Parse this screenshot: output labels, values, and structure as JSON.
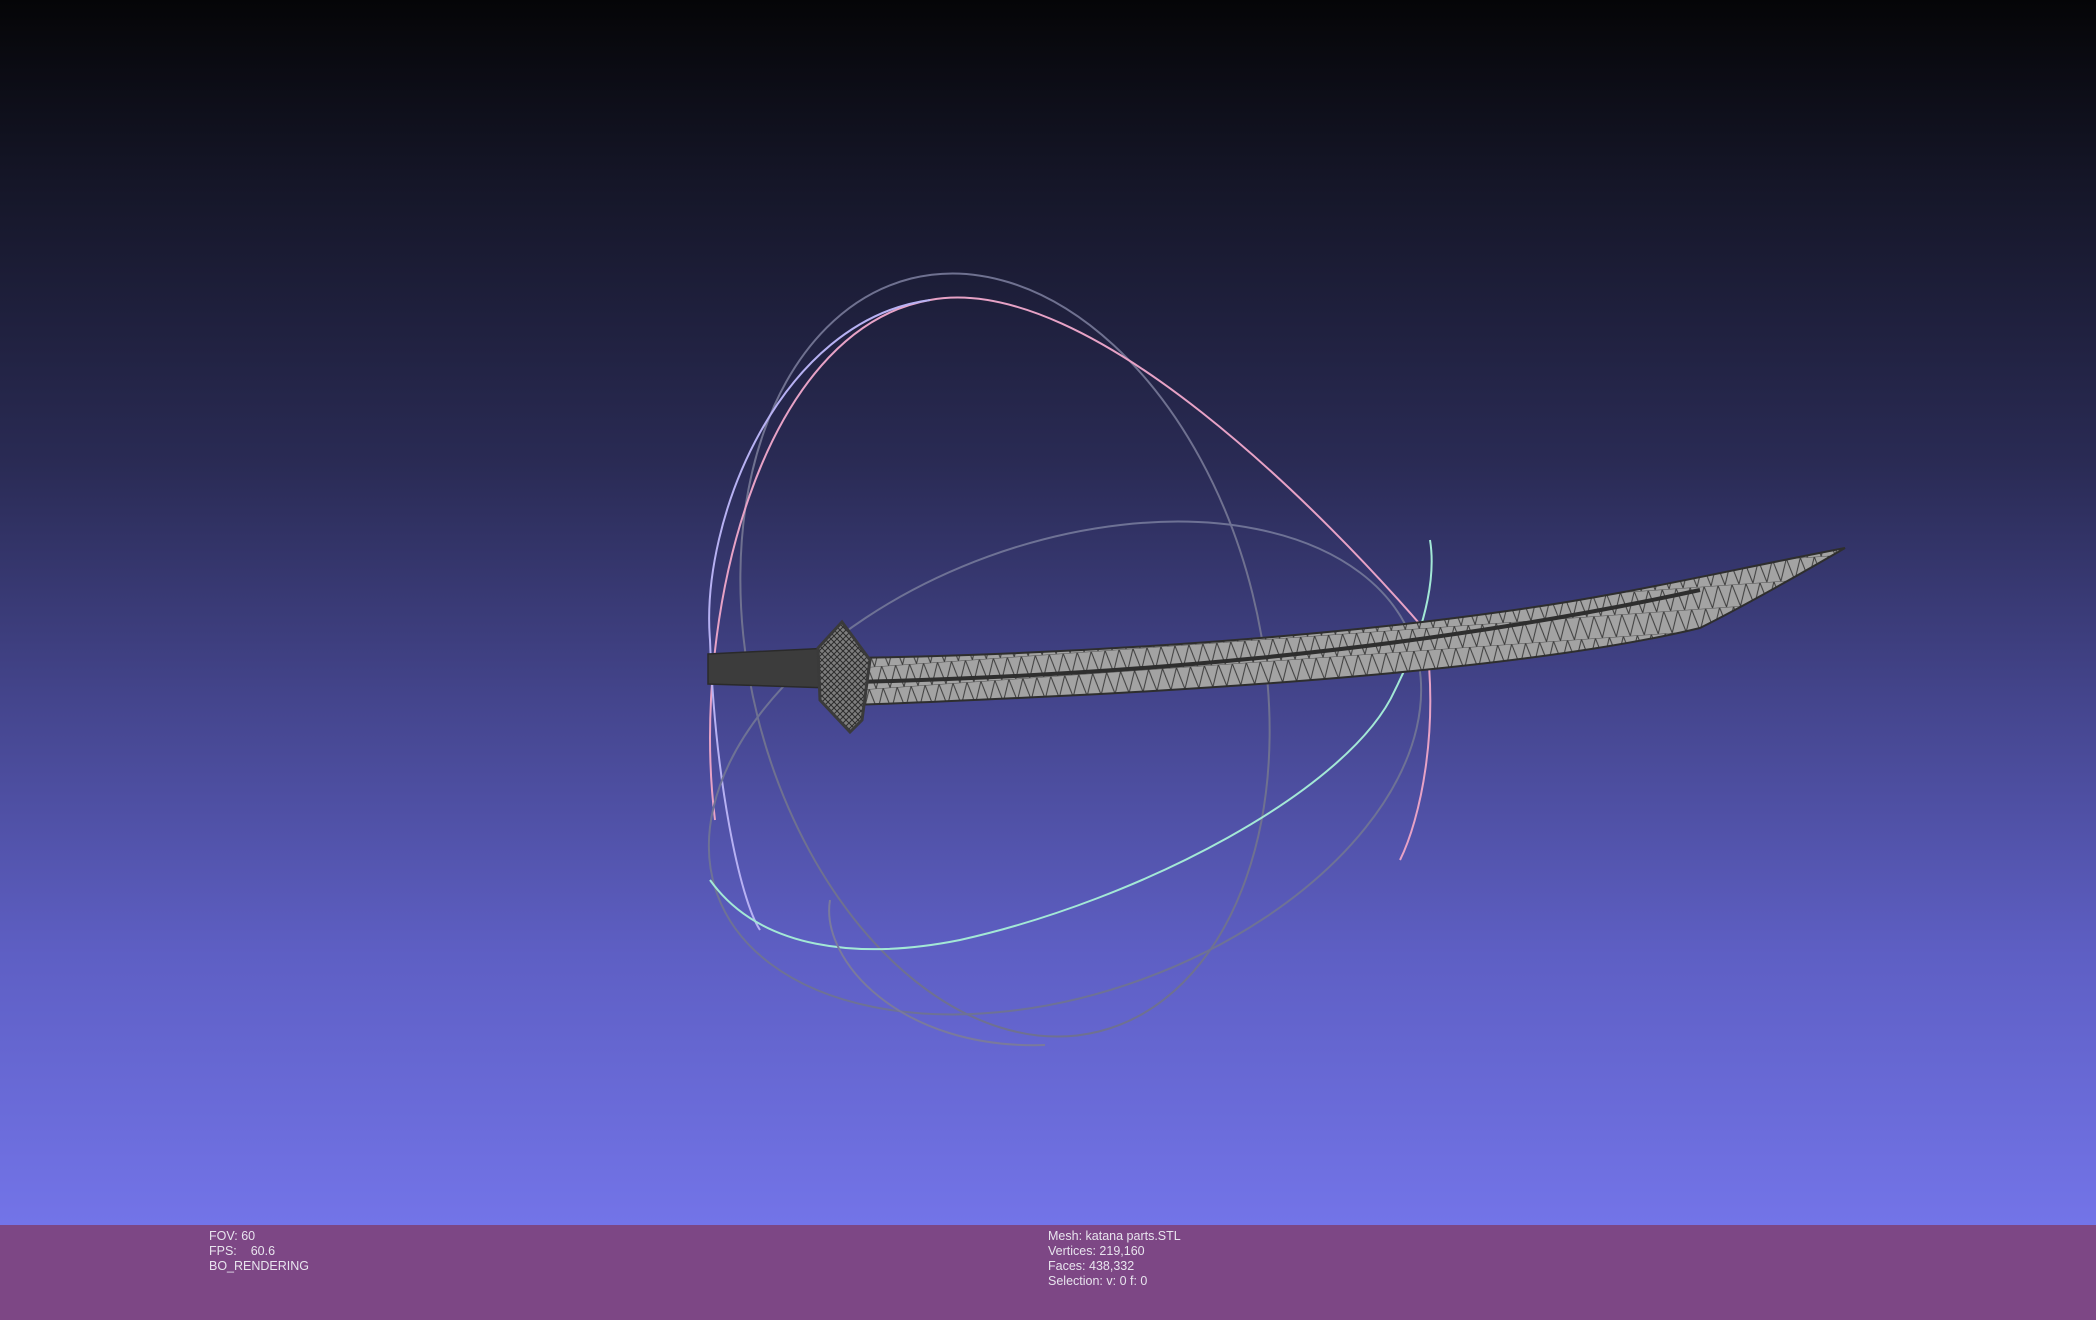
{
  "viewport": {
    "background_top": "#050507",
    "background_bottom": "#7374e8",
    "trackball_colors": {
      "ring_a": "#6f7190",
      "ring_b_pink": "#e8a0c0",
      "ring_c_cyan": "#a0e8d8",
      "ring_d_violet": "#b8b0f0"
    },
    "model_color": "#8a8a8a",
    "model_edge_color": "#2e2e2e"
  },
  "info_bar": {
    "background": "#7d4785",
    "left": {
      "fov_label": "FOV:",
      "fov_value": "60",
      "fps_label": "FPS:",
      "fps_value": "60.6",
      "render_mode": "BO_RENDERING"
    },
    "right": {
      "mesh_label": "Mesh:",
      "mesh_value": "katana parts.STL",
      "vertices_label": "Vertices:",
      "vertices_value": "219,160",
      "faces_label": "Faces:",
      "faces_value": "438,332",
      "selection_label": "Selection:",
      "selection_value": "v: 0 f: 0"
    }
  }
}
